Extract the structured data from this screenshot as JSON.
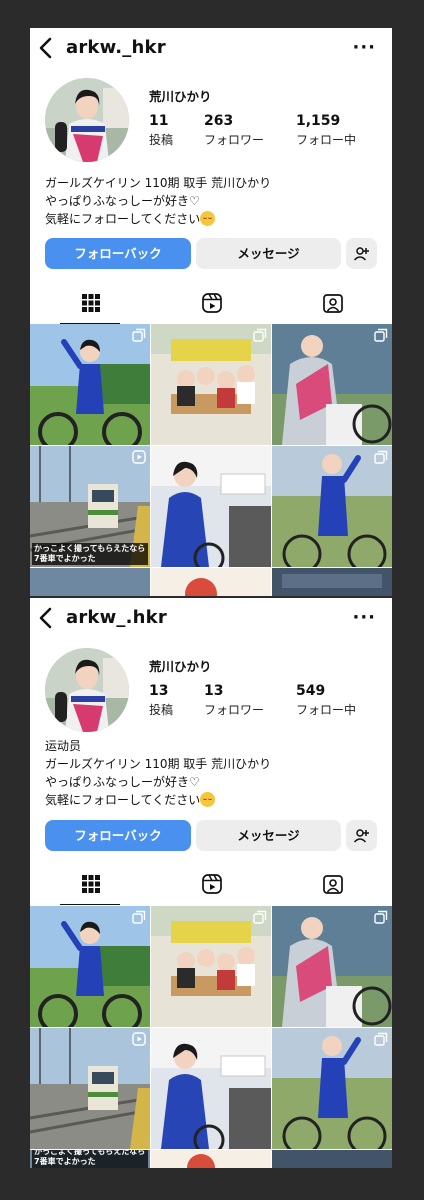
{
  "panels": [
    {
      "username": "arkw._hkr",
      "display_name": "荒川ひかり",
      "stats": [
        {
          "num": "11",
          "label": "投稿"
        },
        {
          "num": "263",
          "label": "フォロワー"
        },
        {
          "num": "1,159",
          "label": "フォロー中"
        }
      ],
      "bio": [
        "ガールズケイリン 110期 取手 荒川ひかり",
        "やっぱりふなっしーが好き♡",
        "気軽にフォローしてください"
      ],
      "buttons": {
        "follow": "フォローバック",
        "message": "メッセージ"
      },
      "caption": "かっこよく撮ってもらえたなら 7番車でよかった"
    },
    {
      "username": "arkw_.hkr",
      "display_name": "荒川ひかり",
      "stats": [
        {
          "num": "13",
          "label": "投稿"
        },
        {
          "num": "13",
          "label": "フォロワー"
        },
        {
          "num": "549",
          "label": "フォロー中"
        }
      ],
      "bio": [
        "运动员",
        "ガールズケイリン 110期 取手 荒川ひかり",
        "やっぱりふなっしーが好き♡",
        "気軽にフォローしてください"
      ],
      "buttons": {
        "follow": "フォローバック",
        "message": "メッセージ"
      },
      "caption": "かっこよく撮ってもらえたなら 7番車でよかった"
    }
  ],
  "colors": {
    "follow_button": "#4a90ee",
    "background": "#2b2b2b"
  }
}
